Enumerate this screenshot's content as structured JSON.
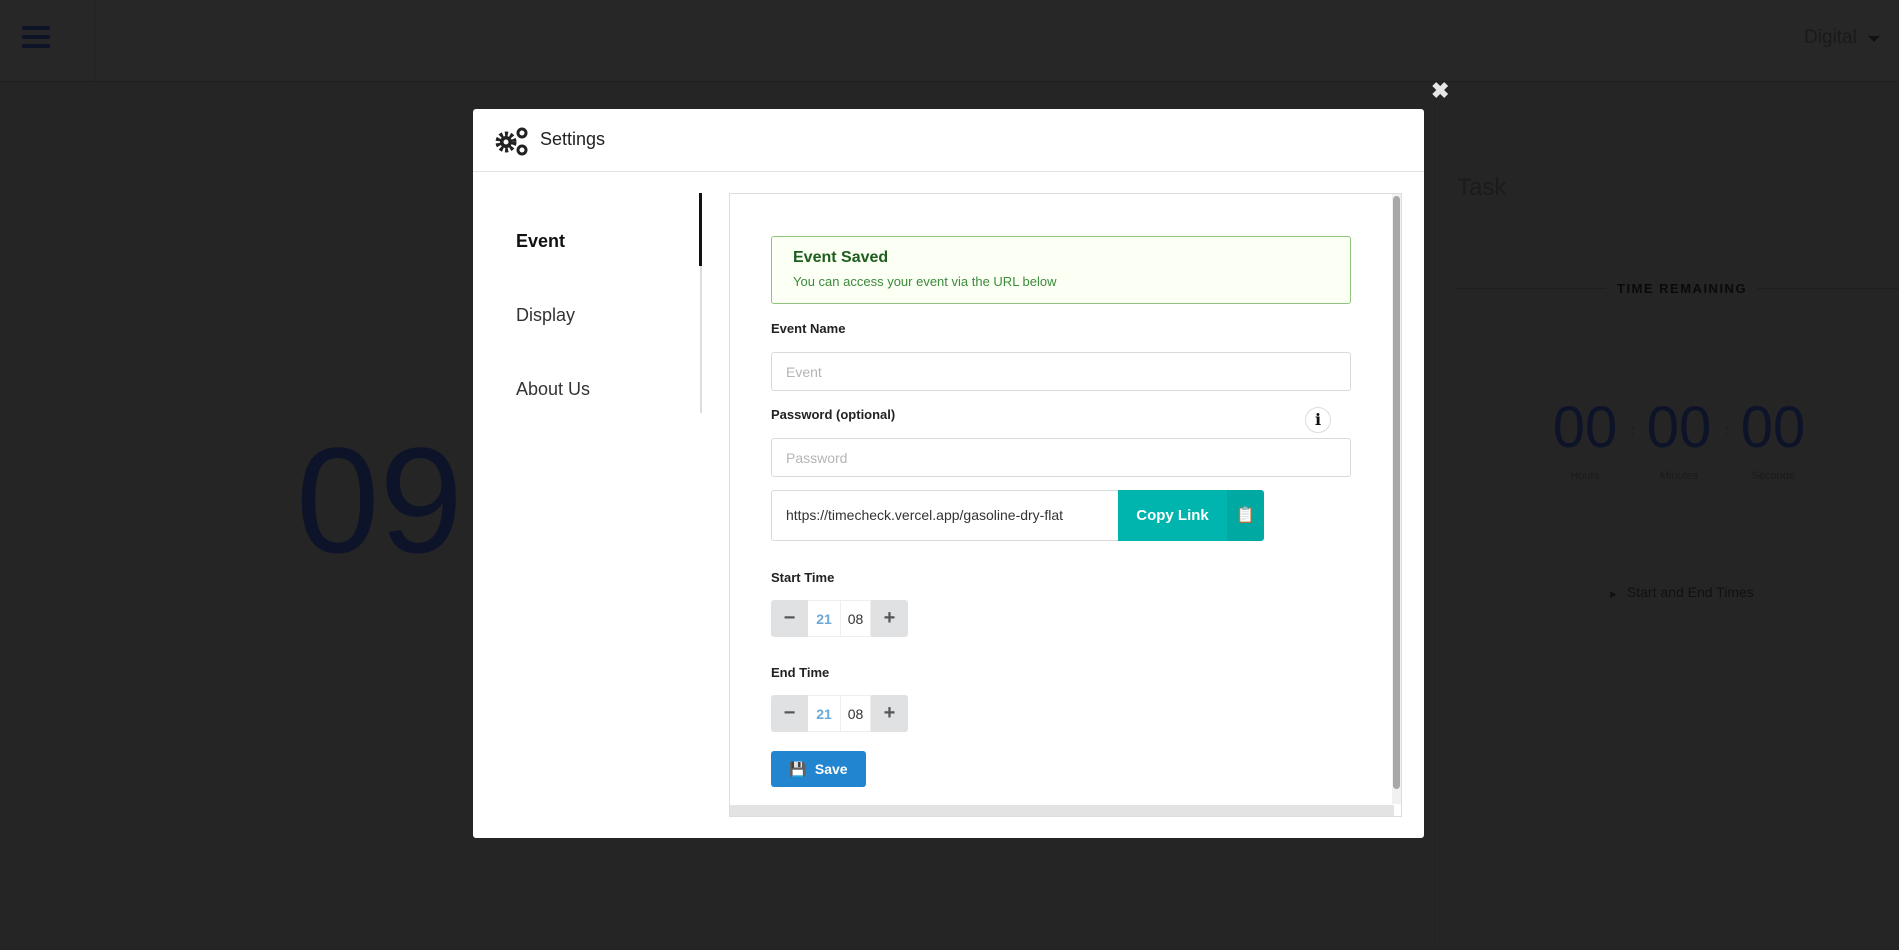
{
  "topbar": {
    "menu_icon": "hamburger-icon",
    "mode_select": "Digital"
  },
  "background": {
    "clock_partial": "09",
    "task_title": "Task",
    "time_remaining": "TIME REMAINING",
    "countdown": [
      {
        "value": "00",
        "label": "Hours"
      },
      {
        "value": "00",
        "label": "Minutes"
      },
      {
        "value": "00",
        "label": "Seconds"
      }
    ],
    "separator": ":",
    "start_end_toggle": "Start and End Times"
  },
  "modal": {
    "title": "Settings",
    "close_icon": "✖",
    "tabs": [
      {
        "label": "Event",
        "active": true
      },
      {
        "label": "Display"
      },
      {
        "label": "About Us"
      }
    ],
    "alert": {
      "title": "Event Saved",
      "message": "You can access your event via the URL below"
    },
    "event_name": {
      "label": "Event Name",
      "placeholder": "Event",
      "value": ""
    },
    "password": {
      "label": "Password (optional)",
      "placeholder": "Password",
      "value": ""
    },
    "url": "https://timecheck.vercel.app/gasoline-dry-flat",
    "copy_label": "Copy Link",
    "start_time": {
      "label": "Start Time",
      "hours": "21",
      "minutes": "08"
    },
    "end_time": {
      "label": "End Time",
      "hours": "21",
      "minutes": "08"
    },
    "save_label": "Save",
    "minus": "−",
    "plus": "+",
    "info": "i"
  },
  "colors": {
    "teal": "#00b5ad",
    "blue": "#2185d0",
    "success_border": "#8fc47d"
  }
}
